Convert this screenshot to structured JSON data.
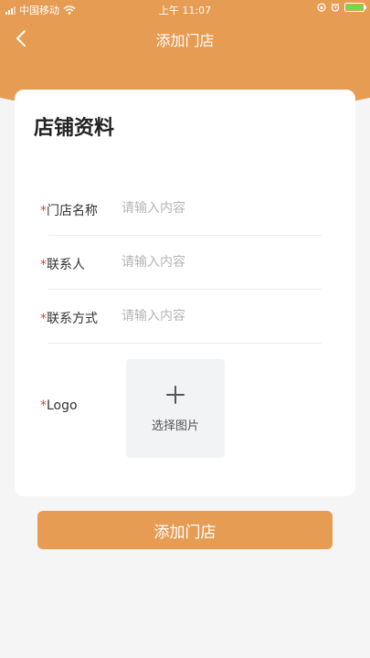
{
  "status_bar": {
    "carrier": "中国移动",
    "time": "上午 11:07"
  },
  "nav": {
    "title": "添加门店"
  },
  "colors": {
    "accent": "#e69c52",
    "required": "#e0442f",
    "background": "#f5f5f5"
  },
  "form": {
    "section_title": "店铺资料",
    "required_mark": "*",
    "fields": [
      {
        "label": "门店名称",
        "value": "",
        "placeholder": "请输入内容"
      },
      {
        "label": "联系人",
        "value": "",
        "placeholder": "请输入内容"
      },
      {
        "label": "联系方式",
        "value": "",
        "placeholder": "请输入内容"
      }
    ],
    "logo": {
      "label": "Logo",
      "upload_text": "选择图片",
      "icon": "plus-icon"
    }
  },
  "submit": {
    "label": "添加门店"
  }
}
